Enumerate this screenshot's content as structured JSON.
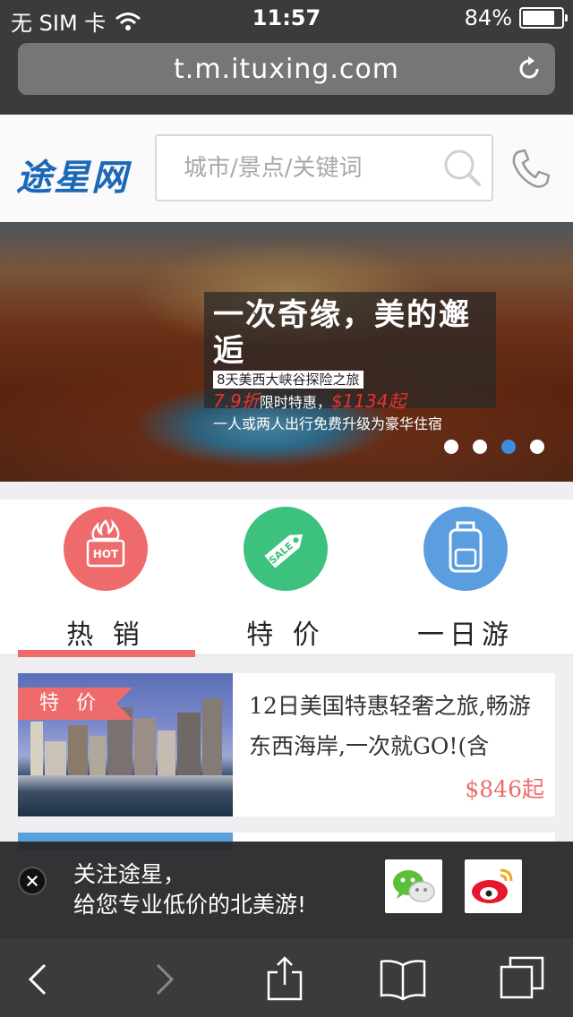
{
  "status_bar": {
    "carrier": "无 SIM 卡",
    "time": "11:57",
    "battery_percent_text": "84%",
    "battery_level": 0.84,
    "icons": [
      "wifi-icon",
      "battery-icon"
    ]
  },
  "browser": {
    "url": "t.m.ituxing.com",
    "icons": [
      "reload-icon",
      "back-icon",
      "forward-icon",
      "share-icon",
      "bookmarks-icon",
      "tabs-icon"
    ]
  },
  "header": {
    "logo_text": "途星网",
    "search_placeholder": "城市/景点/关键词",
    "icons": [
      "search-icon",
      "phone-icon"
    ]
  },
  "banner": {
    "title": "一次奇缘，美的邂逅",
    "subtitle": "8天美西大峡谷探险之旅",
    "discount": "7.9折",
    "deal_text": "限时特惠，",
    "price": "$1134起",
    "note": "一人或两人出行免费升级为豪华住宿",
    "slide_count": 4,
    "active_slide": 3
  },
  "categories": [
    {
      "label": "热 销",
      "icon": "hot-icon",
      "color": "#ef6b6b",
      "selected": true
    },
    {
      "label": "特 价",
      "icon": "sale-tag-icon",
      "color": "#3cc27e",
      "selected": false
    },
    {
      "label": "一日游",
      "icon": "backpack-icon",
      "color": "#5a9ee0",
      "selected": false
    }
  ],
  "product": {
    "tag": "特 价",
    "title": "12日美国特惠轻奢之旅,畅游东西海岸,一次就GO!(含",
    "price": "$846起"
  },
  "follow_bar": {
    "line1": "关注途星，",
    "line2": "给您专业低价的北美游!",
    "icons": [
      "close-icon",
      "wechat-icon",
      "weibo-icon"
    ]
  },
  "colors": {
    "accent": "#ef6b6b",
    "logo_blue": "#1c68b8",
    "active_dot": "#3d8ce0"
  }
}
